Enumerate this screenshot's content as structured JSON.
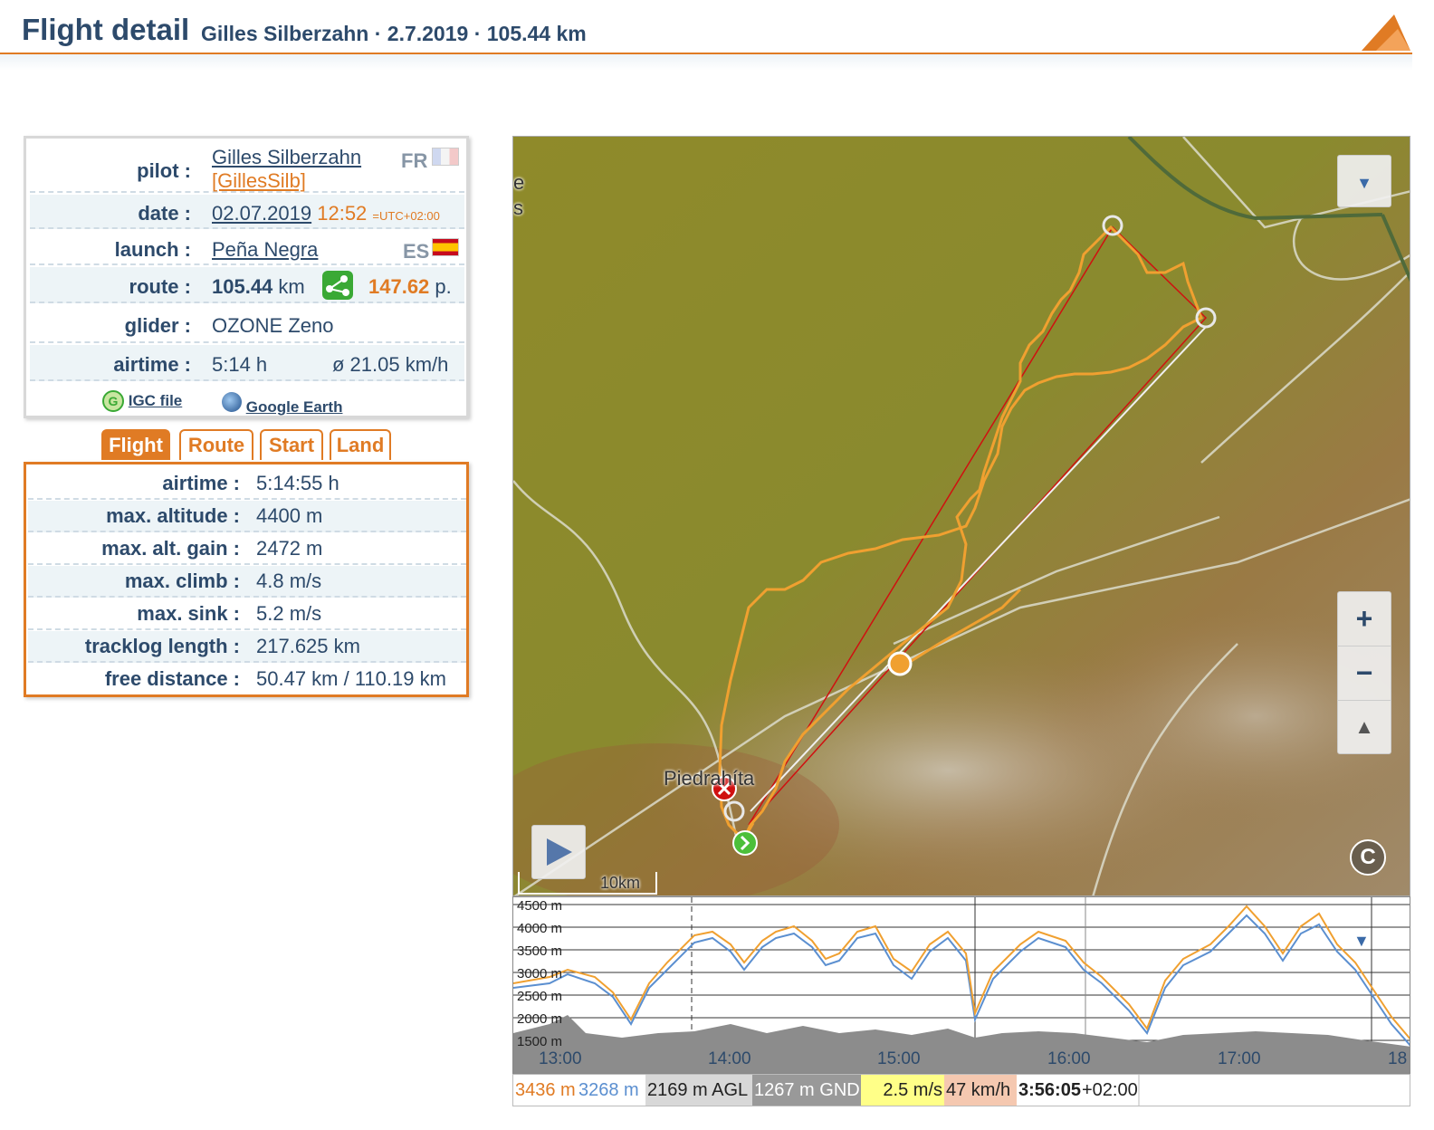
{
  "header": {
    "title": "Flight detail",
    "subtitle": "Gilles Silberzahn · 2.7.2019 · 105.44 km"
  },
  "info": {
    "pilot_label": "pilot :",
    "pilot_name": "Gilles Silberzahn",
    "pilot_nick": "[GillesSilb]",
    "pilot_country": "FR",
    "date_label": "date :",
    "date": "02.07.2019",
    "time": "12:52",
    "utc": "=UTC+02:00",
    "launch_label": "launch :",
    "launch": "Peña Negra",
    "launch_country": "ES",
    "route_label": "route :",
    "route_km": "105.44",
    "route_unit": "km",
    "points": "147.62",
    "points_unit": "p.",
    "glider_label": "glider :",
    "glider": "OZONE Zeno",
    "airtime_label": "airtime :",
    "airtime": "5:14 h",
    "avg_speed": "ø 21.05 km/h",
    "igc_link": "IGC file",
    "ge_link": "Google Earth"
  },
  "tabs": [
    "Flight",
    "Route",
    "Start",
    "Land"
  ],
  "stats": [
    {
      "label": "airtime :",
      "value": "5:14:55 h"
    },
    {
      "label": "max. altitude :",
      "value": "4400 m"
    },
    {
      "label": "max. alt. gain :",
      "value": "2472 m"
    },
    {
      "label": "max. climb :",
      "value": "4.8 m/s"
    },
    {
      "label": "max. sink :",
      "value": "5.2 m/s"
    },
    {
      "label": "tracklog length :",
      "value": "217.625 km"
    },
    {
      "label": "free distance :",
      "value": "50.47 km / 110.19 km"
    }
  ],
  "map": {
    "place": "Piedrahíta",
    "scale": "10km",
    "edge_text_1": "e",
    "edge_text_2": "s",
    "zoom_in": "+",
    "zoom_out": "−",
    "compass": "▲",
    "copyright": "C"
  },
  "profile": {
    "y_ticks": [
      "4500 m",
      "4000 m",
      "3500 m",
      "3000 m",
      "2500 m",
      "2000 m",
      "1500 m"
    ],
    "x_ticks": [
      "13:00",
      "14:00",
      "15:00",
      "16:00",
      "17:00",
      "18"
    ]
  },
  "status": {
    "gps_alt": "3436 m",
    "baro_alt": "3268 m",
    "agl": "2169 m AGL",
    "gnd": "1267 m GND",
    "vario": "2.5 m/s",
    "speed": "47 km/h",
    "time": "3:56:05",
    "tz": "+02:00"
  },
  "colors": {
    "accent": "#e07b24",
    "text": "#2d4a6b",
    "track": "#f0a030",
    "baro": "#5b8fd0",
    "vario_bg": "#ffff88",
    "speed_bg": "#f5c8b0",
    "gnd_bg": "#999999",
    "agl_bg": "#d8d8d8"
  }
}
